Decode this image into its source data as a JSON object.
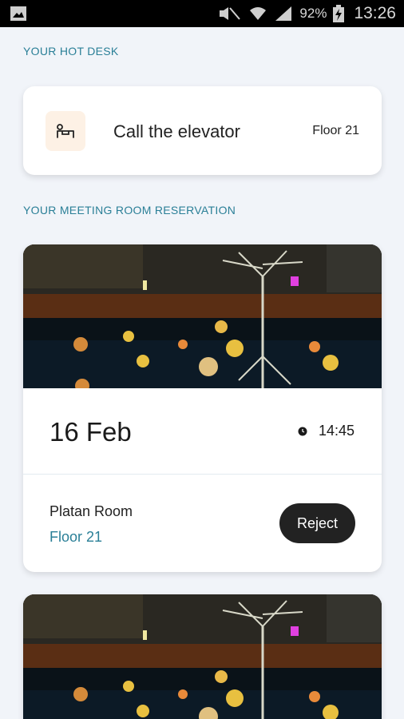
{
  "status_bar": {
    "battery_percent": "92%",
    "time": "13:26"
  },
  "hot_desk": {
    "section_label": "YOUR HOT DESK",
    "title": "Call the elevator",
    "floor": "Floor 21",
    "icon": "desk-icon"
  },
  "meeting": {
    "section_label": "YOUR MEETING ROOM RESERVATION",
    "reservations": [
      {
        "date": "16 Feb",
        "time": "14:45",
        "room": "Platan Room",
        "floor": "Floor 21",
        "reject_label": "Reject"
      }
    ]
  },
  "colors": {
    "accent": "#2a7f97",
    "background": "#f1f4f9",
    "button_dark": "#222222",
    "icon_tile": "#fdf1e5"
  }
}
